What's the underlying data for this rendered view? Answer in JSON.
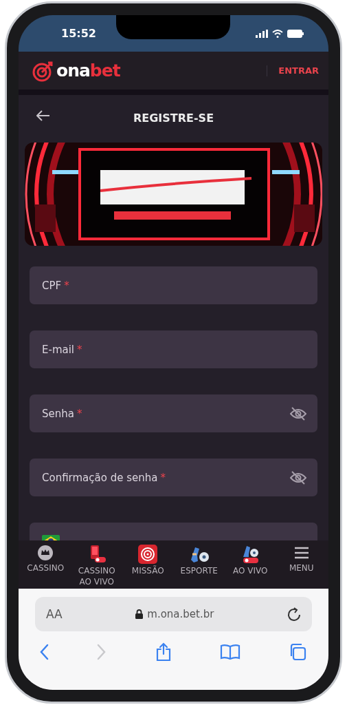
{
  "status_bar": {
    "time": "15:52"
  },
  "header": {
    "logo": {
      "text_1": "ona",
      "text_2": "bet"
    },
    "login_button": "ENTRAR"
  },
  "page": {
    "title": "REGISTRE-SE"
  },
  "form": {
    "fields": [
      {
        "label": "CPF",
        "required_mark": "*",
        "kind": "text"
      },
      {
        "label": "E-mail",
        "required_mark": "*",
        "kind": "text"
      },
      {
        "label": "Senha",
        "required_mark": "*",
        "kind": "password"
      },
      {
        "label": "Confirmação de senha",
        "required_mark": "*",
        "kind": "password"
      },
      {
        "kind": "phone"
      }
    ]
  },
  "bottom_nav": [
    {
      "label": "CASSINO",
      "kind": "casino"
    },
    {
      "label": "CASSINO AO VIVO",
      "kind": "live-casino"
    },
    {
      "label": "MISSÃO",
      "kind": "mission"
    },
    {
      "label": "ESPORTE",
      "kind": "sport"
    },
    {
      "label": "AO VIVO",
      "kind": "live-sport"
    },
    {
      "label": "MENU",
      "kind": "menu"
    }
  ],
  "browser": {
    "text_size": "AA",
    "url": "m.ona.bet.br",
    "toolbar": [
      {
        "kind": "back",
        "disabled": false
      },
      {
        "kind": "forward",
        "disabled": true
      },
      {
        "kind": "share",
        "disabled": false
      },
      {
        "kind": "bookmarks",
        "disabled": false
      },
      {
        "kind": "tabs",
        "disabled": false
      }
    ]
  }
}
